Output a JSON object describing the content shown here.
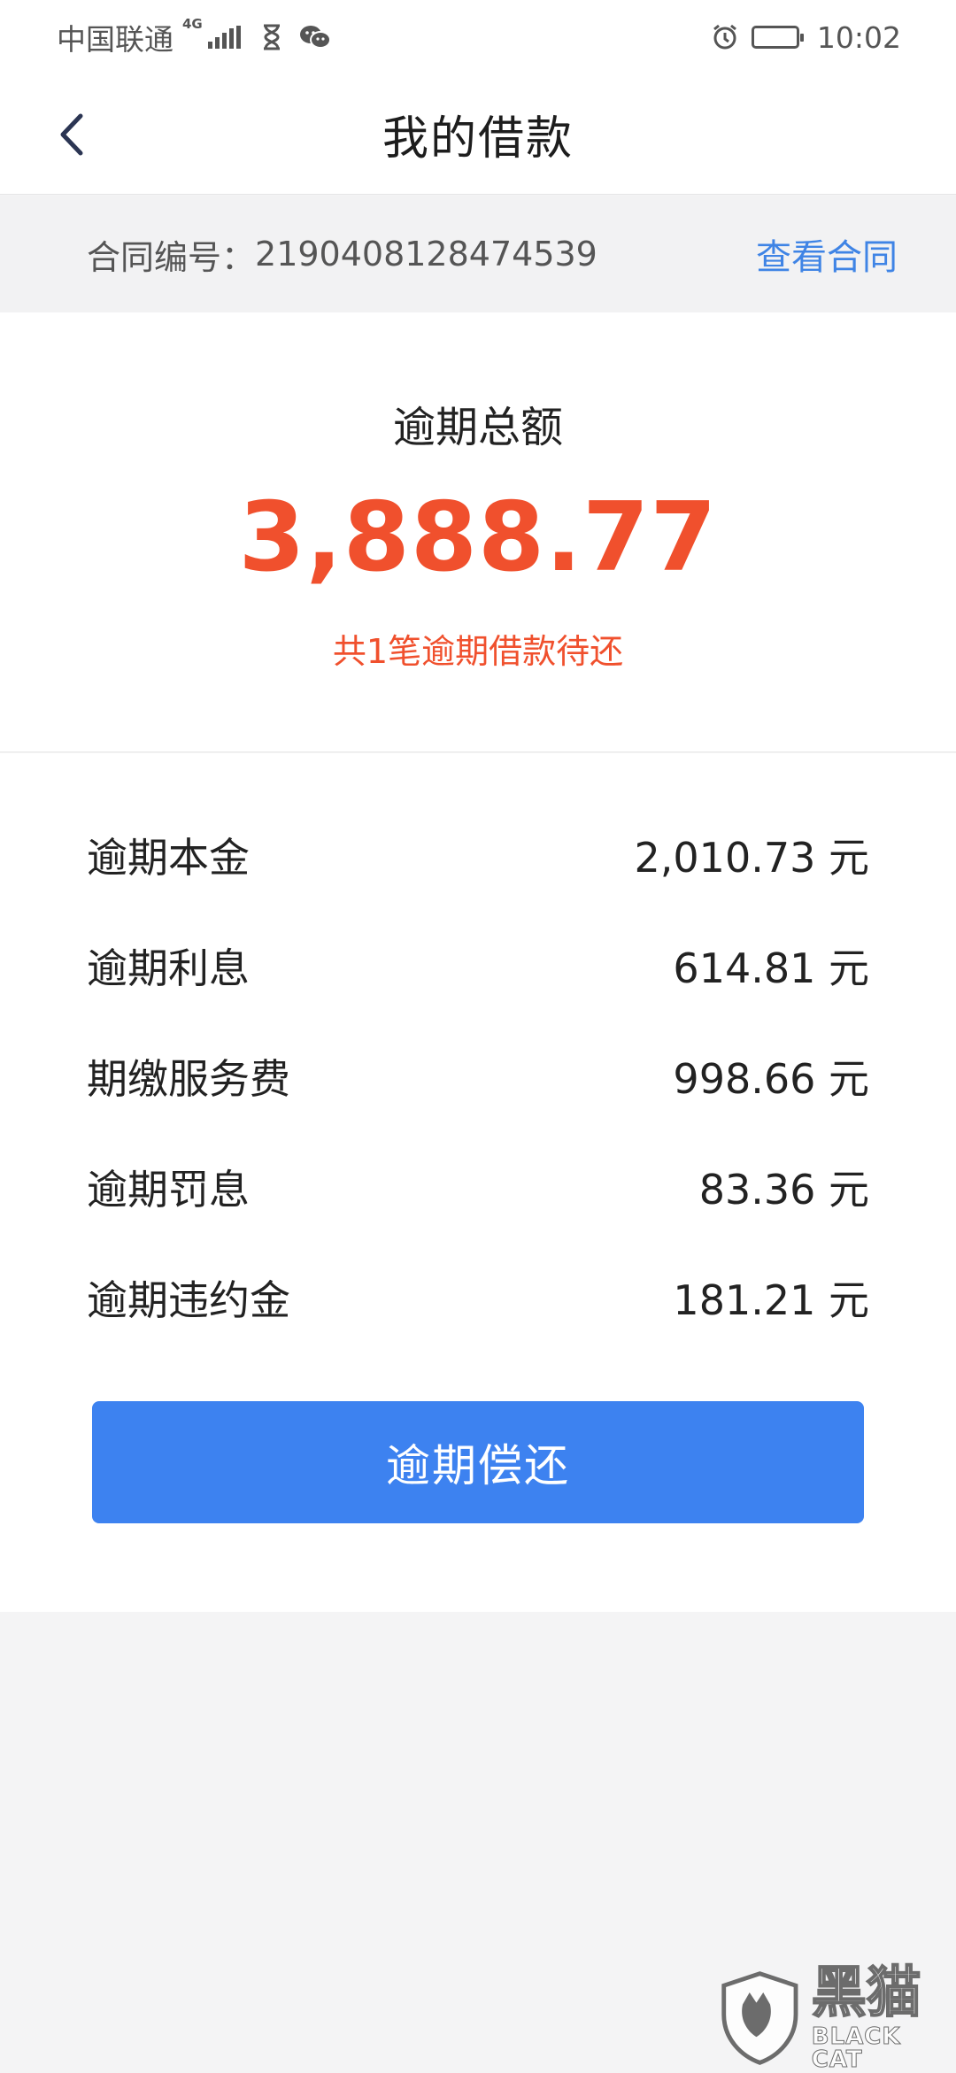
{
  "status_bar": {
    "carrier": "中国联通",
    "network": "4G",
    "time": "10:02"
  },
  "header": {
    "title": "我的借款"
  },
  "contract": {
    "label": "合同编号：",
    "number": "2190408128474539",
    "link_label": "查看合同"
  },
  "summary": {
    "label": "逾期总额",
    "amount": "3,888.77",
    "note": "共1笔逾期借款待还"
  },
  "details": [
    {
      "label": "逾期本金",
      "value": "2,010.73 元"
    },
    {
      "label": "逾期利息",
      "value": "614.81 元"
    },
    {
      "label": "期缴服务费",
      "value": "998.66 元"
    },
    {
      "label": "逾期罚息",
      "value": "83.36 元"
    },
    {
      "label": "逾期违约金",
      "value": "181.21 元"
    }
  ],
  "actions": {
    "repay_label": "逾期偿还"
  },
  "watermark": {
    "cn": "黑猫",
    "en": "BLACK CAT"
  },
  "colors": {
    "accent_blue": "#3d82f0",
    "link_blue": "#3f84e5",
    "overdue_red": "#f0502d"
  }
}
